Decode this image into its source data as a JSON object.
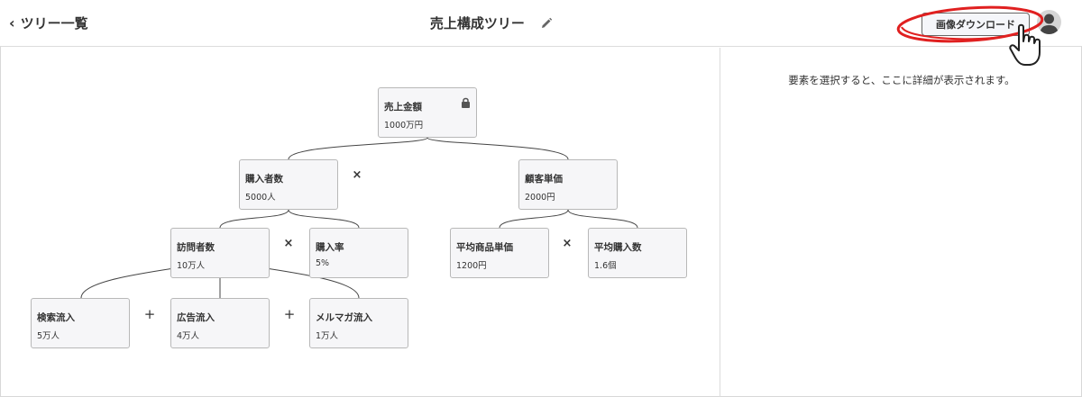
{
  "header": {
    "back_label": "ツリー一覧",
    "title": "売上構成ツリー",
    "download_label": "画像ダウンロード",
    "highlight_color": "#e02020"
  },
  "panel": {
    "message": "要素を選択すると、ここに詳細が表示されます。"
  },
  "tree": {
    "sales": {
      "name": "売上金額",
      "value": "1000万円"
    },
    "buyers": {
      "name": "購入者数",
      "value": "5000人"
    },
    "unit_price": {
      "name": "顧客単価",
      "value": "2000円"
    },
    "visitors": {
      "name": "訪問者数",
      "value": "10万人"
    },
    "cvr": {
      "name": "購入率",
      "value": "5%"
    },
    "avg_item_price": {
      "name": "平均商品単価",
      "value": "1200円"
    },
    "avg_qty": {
      "name": "平均購入数",
      "value": "1.6個"
    },
    "search": {
      "name": "検索流入",
      "value": "5万人"
    },
    "ads": {
      "name": "広告流入",
      "value": "4万人"
    },
    "mailmag": {
      "name": "メルマガ流入",
      "value": "1万人"
    },
    "operators": {
      "times": "×",
      "plus": "+"
    }
  }
}
